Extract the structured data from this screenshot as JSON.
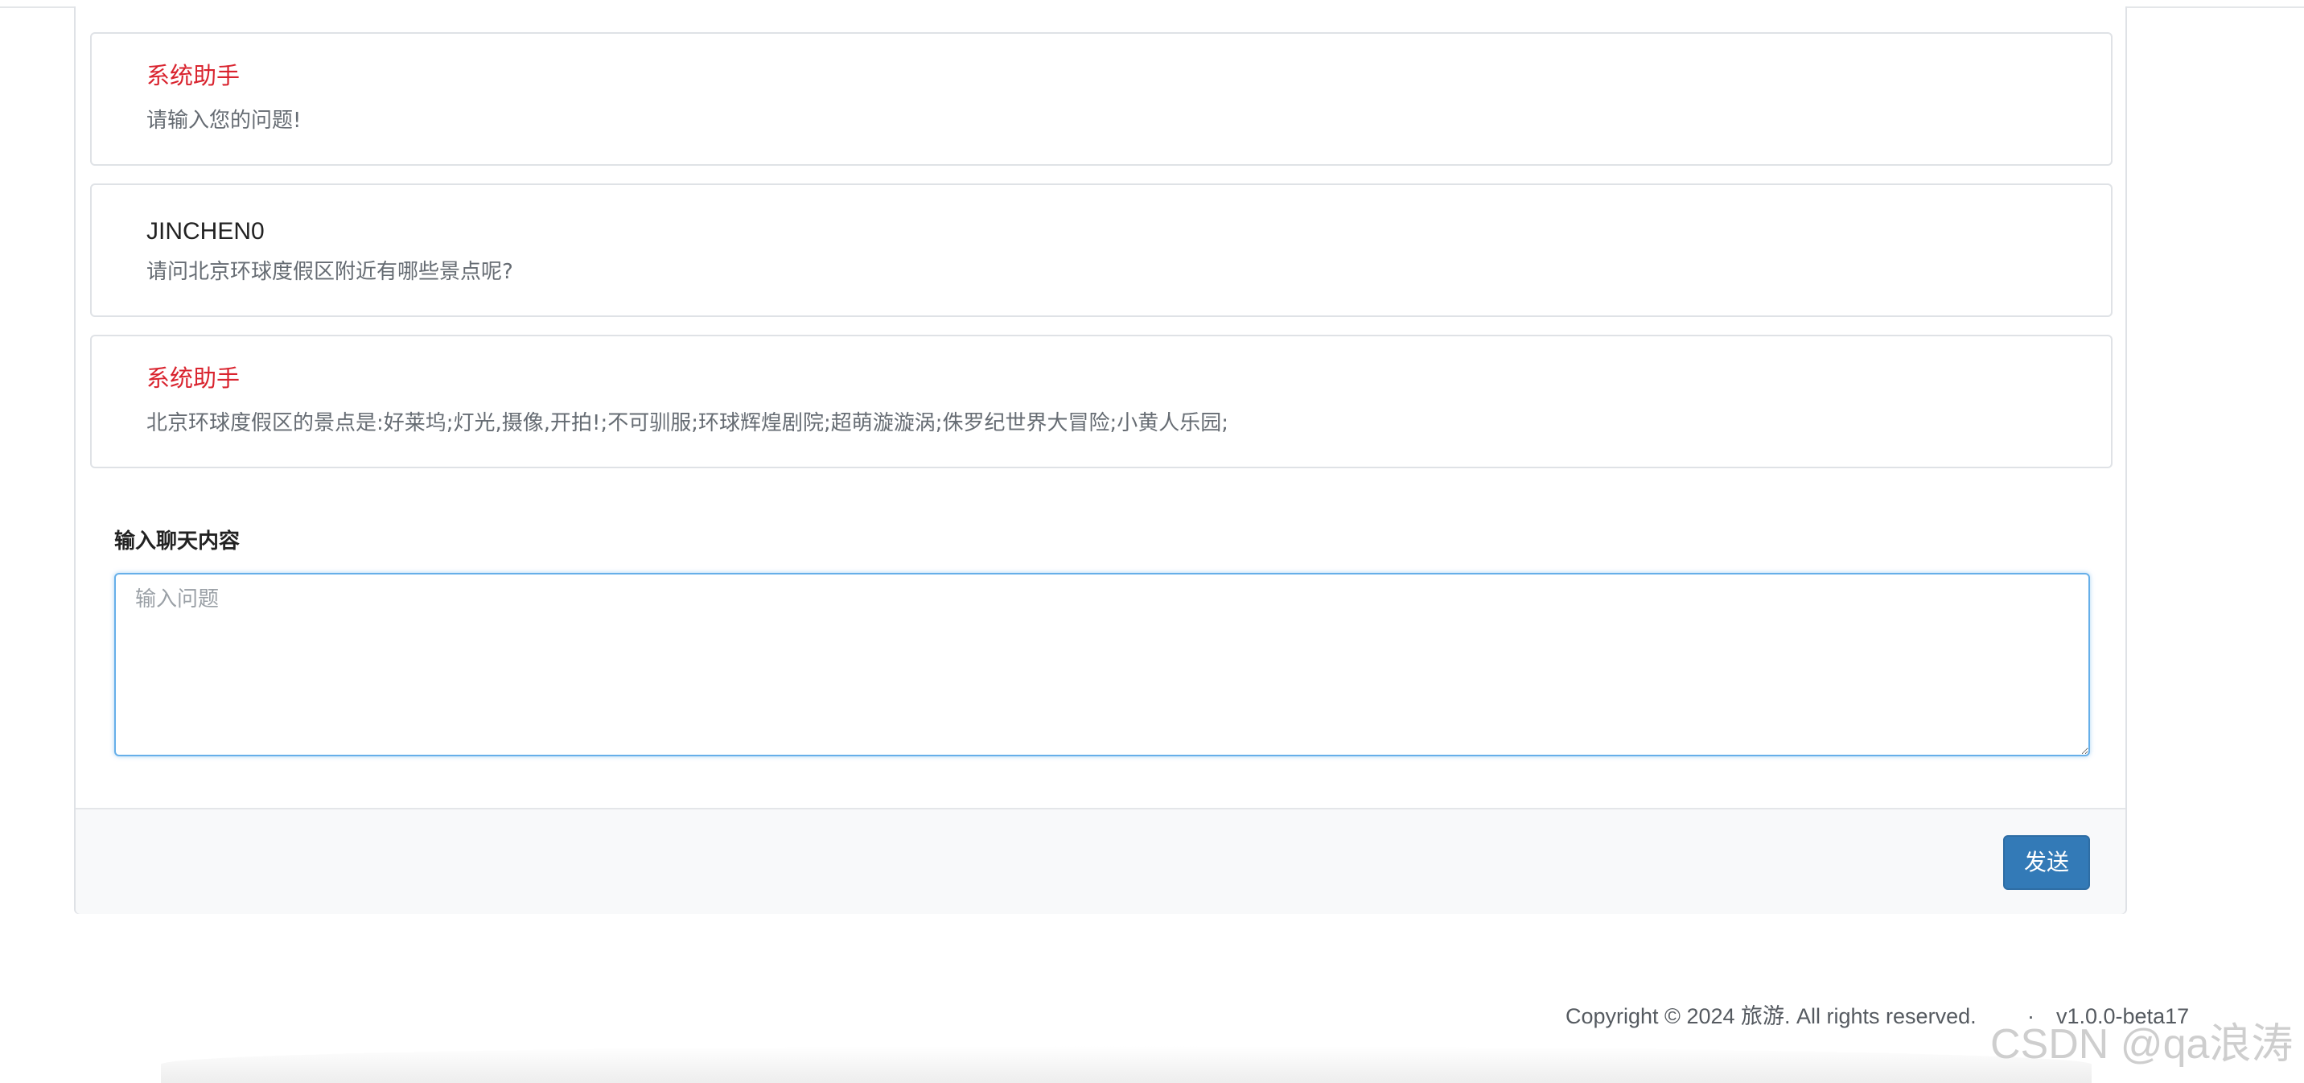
{
  "messages": [
    {
      "sender": "系统助手",
      "text": "请输入您的问题!",
      "role": "system"
    },
    {
      "sender": "JINCHEN0",
      "text": "请问北京环球度假区附近有哪些景点呢?",
      "role": "user"
    },
    {
      "sender": "系统助手",
      "text": "北京环球度假区的景点是:好莱坞;灯光,摄像,开拍!;不可驯服;环球辉煌剧院;超萌漩漩涡;侏罗纪世界大冒险;小黄人乐园;",
      "role": "system"
    }
  ],
  "composer": {
    "label": "输入聊天内容",
    "placeholder": "输入问题",
    "value": ""
  },
  "actions": {
    "send_label": "发送"
  },
  "footer": {
    "copyright": "Copyright © 2024 旅游. All rights reserved.",
    "separator": "·",
    "version": "v1.0.0-beta17"
  },
  "watermark": "CSDN @qa浪涛",
  "colors": {
    "system_sender": "#d9232e",
    "primary_button": "#337ab7",
    "focus_border": "#66afe9"
  }
}
